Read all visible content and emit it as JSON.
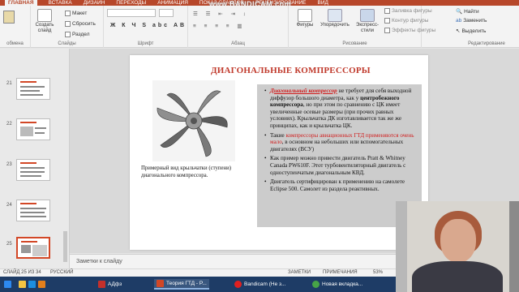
{
  "ribbon": {
    "tabs": [
      "ГЛАВНАЯ",
      "ВСТАВКА",
      "ДИЗАЙН",
      "ПЕРЕХОДЫ",
      "АНИМАЦИЯ",
      "ПОКАЗ СЛАЙДОВ",
      "РЕЦЕНЗИРОВАНИЕ",
      "ВИД"
    ],
    "active_tab": "ГЛАВНАЯ",
    "create_slide": "Создать слайд",
    "layout": "Макет",
    "reset": "Сбросить",
    "section": "Раздел",
    "groups": {
      "clipboard": "обмена",
      "slides": "Слайды",
      "font": "Шрифт",
      "paragraph": "Абзац",
      "drawing": "Рисование",
      "editing": "Редактирование"
    },
    "font_buttons": "Ж К Ч S abc АВ",
    "shapes": "Фигуры",
    "arrange": "Упорядочить",
    "quick_styles": "Экспресс-стили",
    "fill": "Заливка фигуры",
    "outline": "Контур фигуры",
    "effects": "Эффекты фигуры",
    "find": "Найти",
    "replace": "Заменить",
    "select": "Выделить"
  },
  "watermark": "www.BANDICAM.com",
  "slide": {
    "title": "ДИАГОНАЛЬНЫЕ КОМПРЕССОРЫ",
    "caption": "Примерный вид крыльчатки (ступени) диагонального компрессора.",
    "bullets": {
      "b1_a": "Диагональный компрессор",
      "b1_b": " не требует для себя выходной диффузор большого диаметра, как у ",
      "b1_c": "центробежного компрессора",
      "b1_d": ", но при этом по сравнению с ЦК имеет увеличенные осевые размеры (при прочих равных условиях). Крыльчатка ДК изготавливается так же же принципах, как и крыльчатка ЦК.",
      "b2_a": "Такие ",
      "b2_b": "компрессоры авиационных ГТД применяются очень мало",
      "b2_c": ", в основном на небольших или вспомогательных двигателях (ВСУ)",
      "b3": "Как пример можно привести двигатель Pratt & Whitney Canada PW610F. Этот турбовентиляторный двигатель с одноступенчатым диагональным КВД.",
      "b4": "Двигатель сертифицирован к применению на самолете Eclipse 500. Самолет из раздела реактивных."
    }
  },
  "notes_placeholder": "Заметки к слайду",
  "status": {
    "slide_num": "СЛАЙД 25 ИЗ 34",
    "language": "РУССКИЙ",
    "notes": "ЗАМЕТКИ",
    "comments": "ПРИМЕЧАНИЯ",
    "zoom": "53%"
  },
  "thumbnails": {
    "numbers": [
      "21",
      "22",
      "23",
      "24",
      "25"
    ]
  },
  "taskbar": {
    "items": [
      "АДфз",
      "Теория ГТД - P...",
      "Bandicam (Не з...",
      "Новая вкладка..."
    ]
  },
  "colors": {
    "accent": "#b7472a",
    "title_red": "#c0392b",
    "taskbar": "#1e3c66"
  }
}
